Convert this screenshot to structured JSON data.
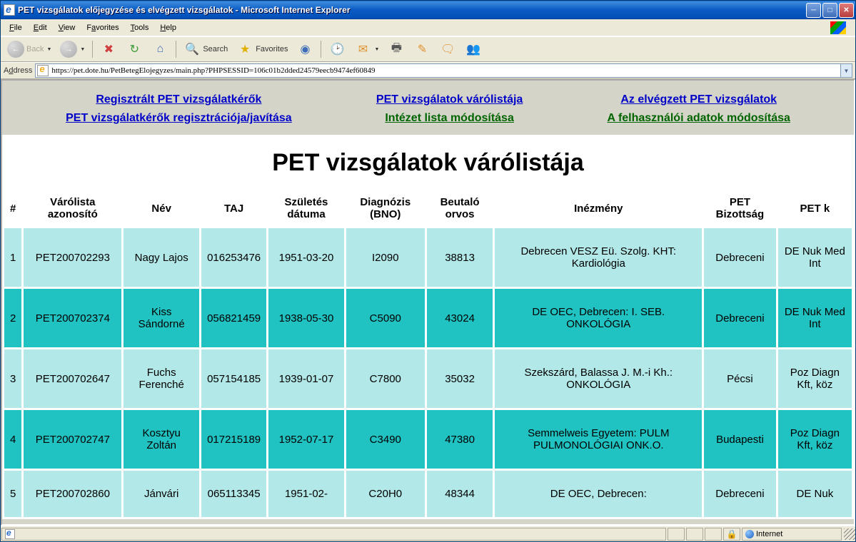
{
  "window": {
    "title": "PET vizsgálatok előjegyzése és elvégzett vizsgálatok - Microsoft Internet Explorer"
  },
  "menu": {
    "file": "File",
    "edit": "Edit",
    "view": "View",
    "favorites": "Favorites",
    "tools": "Tools",
    "help": "Help"
  },
  "toolbar": {
    "back": "Back",
    "search": "Search",
    "favorites": "Favorites"
  },
  "address": {
    "label": "Address",
    "url": "https://pet.dote.hu/PetBetegElojegyzes/main.php?PHPSESSID=106c01b2dded24579eecb9474ef60849"
  },
  "nav": {
    "row1": {
      "left": "Regisztrált PET vizsgálatkérők",
      "center": "PET vizsgálatok várólistája",
      "right": "Az elvégzett PET vizsgálatok"
    },
    "row2": {
      "left": "PET vizsgálatkérők regisztrációja/javítása",
      "center": "Intézet lista módosítása",
      "right": "A felhasználói adatok módosítása"
    }
  },
  "page": {
    "title": "PET vizsgálatok várólistája"
  },
  "table": {
    "headers": {
      "num": "#",
      "waitlist_id": "Várólista azonosító",
      "name": "Név",
      "taj": "TAJ",
      "dob": "Születés dátuma",
      "diag": "Diagnózis (BNO)",
      "referrer": "Beutaló orvos",
      "institution": "Inézmény",
      "committee": "PET Bizottság",
      "petk": "PET k"
    },
    "rows": [
      {
        "num": "1",
        "wid": "PET200702293",
        "name": "Nagy Lajos",
        "taj": "016253476",
        "dob": "1951-03-20",
        "diag": "I2090",
        "ref": "38813",
        "inst": "Debrecen VESZ Eü. Szolg. KHT: Kardiológia",
        "comm": "Debreceni",
        "petk": "DE Nuk Med Int"
      },
      {
        "num": "2",
        "wid": "PET200702374",
        "name": "Kiss Sándorné",
        "taj": "056821459",
        "dob": "1938-05-30",
        "diag": "C5090",
        "ref": "43024",
        "inst": "DE OEC, Debrecen: I. SEB. ONKOLÓGIA",
        "comm": "Debreceni",
        "petk": "DE Nuk Med Int"
      },
      {
        "num": "3",
        "wid": "PET200702647",
        "name": "Fuchs Ferenché",
        "taj": "057154185",
        "dob": "1939-01-07",
        "diag": "C7800",
        "ref": "35032",
        "inst": "Szekszárd, Balassa J. M.-i Kh.: ONKOLÓGIA",
        "comm": "Pécsi",
        "petk": "Poz Diagn Kft, köz"
      },
      {
        "num": "4",
        "wid": "PET200702747",
        "name": "Kosztyu Zoltán",
        "taj": "017215189",
        "dob": "1952-07-17",
        "diag": "C3490",
        "ref": "47380",
        "inst": "Semmelweis Egyetem: PULM PULMONOLÓGIAI ONK.O.",
        "comm": "Budapesti",
        "petk": "Poz Diagn Kft, köz"
      },
      {
        "num": "5",
        "wid": "PET200702860",
        "name": "Jánvári",
        "taj": "065113345",
        "dob": "1951-02-",
        "diag": "C20H0",
        "ref": "48344",
        "inst": "DE OEC, Debrecen:",
        "comm": "Debreceni",
        "petk": "DE Nuk"
      }
    ]
  },
  "status": {
    "zone": "Internet"
  }
}
